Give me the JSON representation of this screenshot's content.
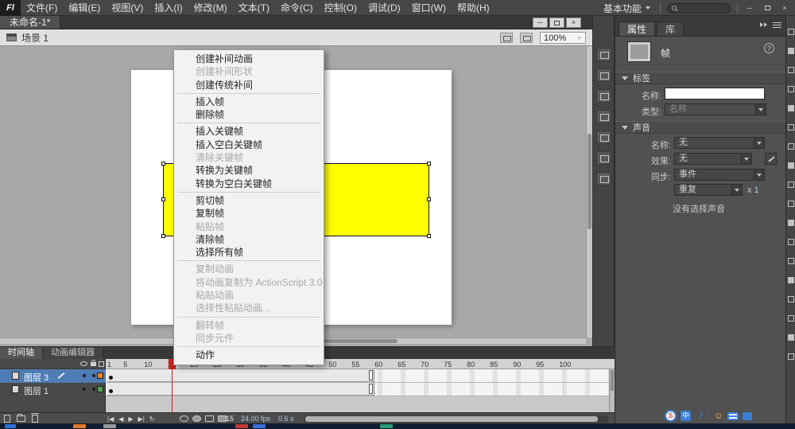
{
  "menubar": {
    "logo": "Fl",
    "menus": [
      "文件(F)",
      "编辑(E)",
      "视图(V)",
      "插入(I)",
      "修改(M)",
      "文本(T)",
      "命令(C)",
      "控制(O)",
      "调试(D)",
      "窗口(W)",
      "帮助(H)"
    ],
    "workspace_button": "基本功能",
    "window_controls": {
      "minimize": "─",
      "close": "×"
    }
  },
  "document_window": {
    "tab_title": "未命名-1*",
    "controls": {
      "minimize": "─",
      "close": "×"
    }
  },
  "scene_bar": {
    "scene_name": "场景 1",
    "zoom_value": "100%"
  },
  "context_menu": {
    "items": [
      {
        "label": "创建补间动画",
        "enabled": true
      },
      {
        "label": "创建补间形状",
        "enabled": false
      },
      {
        "label": "创建传统补间",
        "enabled": true
      },
      {
        "separator": true
      },
      {
        "label": "插入帧",
        "enabled": true
      },
      {
        "label": "删除帧",
        "enabled": true
      },
      {
        "separator": true
      },
      {
        "label": "插入关键帧",
        "enabled": true
      },
      {
        "label": "插入空白关键帧",
        "enabled": true
      },
      {
        "label": "清除关键帧",
        "enabled": false
      },
      {
        "label": "转换为关键帧",
        "enabled": true
      },
      {
        "label": "转换为空白关键帧",
        "enabled": true
      },
      {
        "separator": true
      },
      {
        "label": "剪切帧",
        "enabled": true
      },
      {
        "label": "复制帧",
        "enabled": true
      },
      {
        "label": "粘贴帧",
        "enabled": false
      },
      {
        "label": "清除帧",
        "enabled": true
      },
      {
        "label": "选择所有帧",
        "enabled": true
      },
      {
        "separator": true
      },
      {
        "label": "复制动画",
        "enabled": false
      },
      {
        "label": "将动画复制为 ActionScript 3.0...",
        "enabled": false
      },
      {
        "label": "粘贴动画",
        "enabled": false
      },
      {
        "label": "选择性粘贴动画...",
        "enabled": false
      },
      {
        "separator": true
      },
      {
        "label": "翻转帧",
        "enabled": false
      },
      {
        "label": "同步元件",
        "enabled": false
      },
      {
        "separator": true
      },
      {
        "label": "动作",
        "enabled": true
      }
    ]
  },
  "timeline": {
    "tabs": [
      {
        "label": "时间轴",
        "active": true
      },
      {
        "label": "动画编辑器",
        "active": false
      }
    ],
    "layers": [
      {
        "name": "图层 3",
        "selected": true,
        "color": "#E8822D"
      },
      {
        "name": "图层 1",
        "selected": false,
        "color": "#55A555"
      }
    ],
    "ruler_numbers": [
      1,
      5,
      10,
      15,
      20,
      25,
      30,
      35,
      40,
      45,
      50,
      55,
      60,
      65,
      70,
      75,
      80,
      85,
      90,
      95,
      100
    ],
    "current_frame": "15",
    "frame_rate": "24.00 fps",
    "elapsed_time": "0.6 s",
    "span_end_frame": 58,
    "playback_buttons": [
      "|◀",
      "◀",
      "▶",
      "▶|",
      "↻"
    ]
  },
  "properties_panel": {
    "tabs": [
      {
        "label": "属性",
        "active": true
      },
      {
        "label": "库",
        "active": false
      }
    ],
    "selection_type": "帧",
    "label_section": {
      "title": "标签",
      "name_label": "名称:",
      "name_value": "",
      "type_label": "类型:",
      "type_value": "名称"
    },
    "sound_section": {
      "title": "声音",
      "name_label": "名称:",
      "name_value": "无",
      "effect_label": "效果:",
      "effect_value": "无",
      "sync_label": "同步:",
      "sync_value": "事件",
      "repeat_value": "重复",
      "times_label": "x",
      "times_count": "1",
      "status": "没有选择声音"
    }
  },
  "stage": {
    "fill_color": "#FFFF00"
  },
  "dock_icons": [
    "align-panel-icon",
    "info-panel-icon",
    "color-panel-icon",
    "swatches-panel-icon",
    "transform-panel-icon",
    "code-snippets-panel-icon",
    "motion-presets-panel-icon"
  ],
  "tool_icons": [
    "selection-tool-icon",
    "subselection-tool-icon",
    "free-transform-tool-icon",
    "3d-rotation-tool-icon",
    "lasso-tool-icon",
    "pen-tool-icon",
    "text-tool-icon",
    "line-tool-icon",
    "rectangle-tool-icon",
    "pencil-tool-icon",
    "brush-tool-icon",
    "deco-tool-icon",
    "bone-tool-icon",
    "paint-bucket-tool-icon",
    "eyedropper-tool-icon",
    "eraser-tool-icon",
    "hand-tool-icon",
    "zoom-tool-icon"
  ],
  "ime_bar": {
    "icons": [
      {
        "name": "sogou-logo-icon",
        "glyph": "S"
      },
      {
        "name": "ime-mode-icon",
        "glyph": "中"
      },
      {
        "name": "ime-halfmoon-icon",
        "glyph": "☽"
      },
      {
        "name": "ime-punctuation-icon",
        "glyph": "’"
      },
      {
        "name": "ime-emoji-icon",
        "glyph": "☺"
      },
      {
        "name": "ime-keyboard-icon",
        "glyph": ""
      },
      {
        "name": "ime-toolbox-icon",
        "glyph": ""
      }
    ]
  },
  "taskbar": {
    "items": [
      {
        "name": "start-button",
        "color": "#2f6fd8"
      },
      {
        "name": "taskbar-item",
        "color": "#e07a2e"
      },
      {
        "name": "taskbar-item",
        "color": "#9a9a9a"
      },
      {
        "name": "taskbar-item",
        "color": "#c23a32"
      },
      {
        "name": "taskbar-item",
        "color": "#3a6fd8"
      },
      {
        "name": "taskbar-item",
        "color": "#2a9a7a"
      }
    ]
  }
}
